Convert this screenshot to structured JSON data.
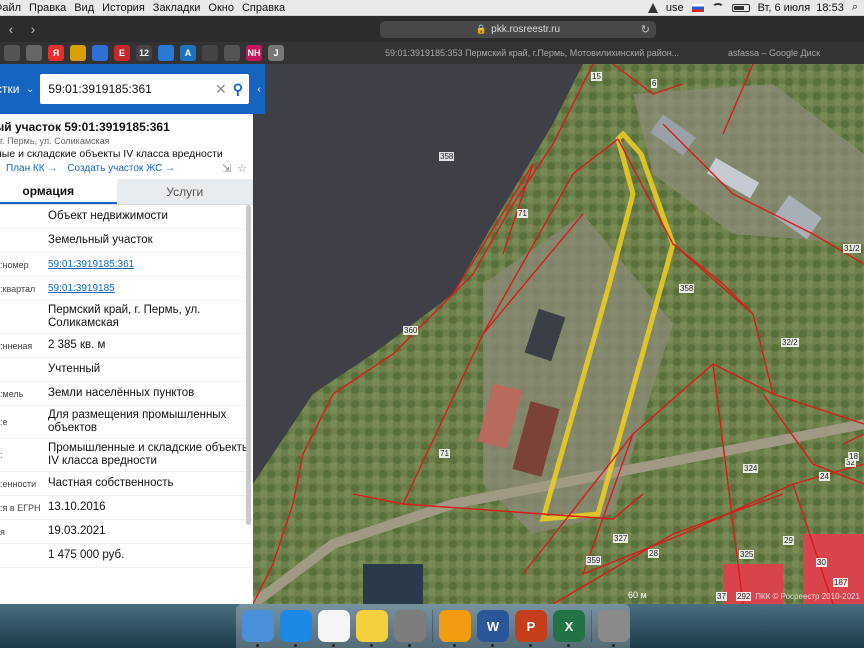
{
  "menubar": {
    "items": [
      "Файл",
      "Правка",
      "Вид",
      "История",
      "Закладки",
      "Окно",
      "Справка"
    ],
    "user": "use",
    "datetime": "Вт, 6 июля  18:53"
  },
  "browser": {
    "url": "pkk.rosreestr.ru",
    "bookmarks": [
      {
        "icon": "apps-icon",
        "label": "",
        "color": "#555"
      },
      {
        "icon": "tab-icon",
        "label": "",
        "color": "#666"
      },
      {
        "icon": "yandex-icon",
        "label": "Я",
        "color": "#e62e2e"
      },
      {
        "icon": "bookmark-icon",
        "label": "",
        "color": "#d8a000"
      },
      {
        "icon": "mail-icon",
        "label": "",
        "color": "#2f6fd6"
      },
      {
        "icon": "e-icon",
        "label": "E",
        "color": "#c62828"
      },
      {
        "icon": "twelve-icon",
        "label": "12",
        "color": "#444"
      },
      {
        "icon": "star-icon",
        "label": "",
        "color": "#2a7ad5"
      },
      {
        "icon": "a-icon",
        "label": "A",
        "color": "#1e73be"
      },
      {
        "icon": "dots-icon",
        "label": "",
        "color": "#444"
      },
      {
        "icon": "globe-icon",
        "label": "",
        "color": "#555"
      },
      {
        "icon": "nh-icon",
        "label": "NH",
        "color": "#c2185b"
      },
      {
        "icon": "j-icon",
        "label": "J",
        "color": "#777"
      }
    ],
    "tab_title": "59:01:3919185:353 Пермский край, г.Пермь, Мотовилихинский район...",
    "tab_title2": "asfassa – Google Диск"
  },
  "panel": {
    "search_type": "стки",
    "search_value": "59:01:3919185:361",
    "title": "ый участок 59:01:3919185:361",
    "address": "г. Пермь, ул. Соликамская",
    "purpose": "ные и складские объекты IV класса вредности",
    "link_plan": "План КК",
    "link_create": "Создать участок ЖС",
    "tab_info": "ормация",
    "tab_services": "Услуги",
    "rows": [
      {
        "key": "",
        "value": "Объект недвижимости",
        "link": false
      },
      {
        "key": "",
        "value": "Земельный участок",
        "link": false
      },
      {
        "key": "номер:",
        "value": "59:01:3919185:361",
        "link": true
      },
      {
        "key": "квартал:",
        "value": "59:01:3919185",
        "link": true
      },
      {
        "key": "",
        "value": "Пермский край, г. Пермь, ул. Соликамская",
        "link": false
      },
      {
        "key": "нненая:",
        "value": "2 385 кв. м",
        "link": false
      },
      {
        "key": "",
        "value": "Учтенный",
        "link": false
      },
      {
        "key": "мель:",
        "value": "Земли населённых пунктов",
        "link": false
      },
      {
        "key": "е:",
        "value": "Для размещения промышленных объектов",
        "link": false
      },
      {
        "key": ":",
        "value": "Промышленные и складские объекты IV класса вредности",
        "link": false
      },
      {
        "key": "енности:",
        "value": "Частная собственность",
        "link": false
      },
      {
        "key": "я в ЕГРН:",
        "value": "13.10.2016",
        "link": false
      },
      {
        "key": "я",
        "value": "19.03.2021",
        "link": false
      },
      {
        "key": "",
        "value": "1 475 000 руб.",
        "link": false
      }
    ]
  },
  "map": {
    "labels": [
      "358",
      "360",
      "358",
      "71",
      "71",
      "359",
      "327",
      "28",
      "324",
      "325",
      "37",
      "292",
      "30",
      "187",
      "31/2",
      "32/2",
      "6",
      "15",
      "24",
      "29",
      "32",
      "18"
    ],
    "scale": "60 м",
    "attribution": "ПКК © Росреестр 2010-2021"
  },
  "dock": {
    "apps": [
      {
        "name": "finder-icon",
        "label": "",
        "color": "#4a90d9"
      },
      {
        "name": "safari-icon",
        "label": "",
        "color": "#1e88e5"
      },
      {
        "name": "photos-icon",
        "label": "",
        "color": "#f5f5f5"
      },
      {
        "name": "notes-icon",
        "label": "",
        "color": "#f4d03f"
      },
      {
        "name": "preferences-icon",
        "label": "",
        "color": "#7d7d7d"
      },
      {
        "name": "vlc-icon",
        "label": "",
        "color": "#f39c12"
      },
      {
        "name": "word-icon",
        "label": "W",
        "color": "#2b579a"
      },
      {
        "name": "powerpoint-icon",
        "label": "P",
        "color": "#c43e1c"
      },
      {
        "name": "excel-icon",
        "label": "X",
        "color": "#217346"
      },
      {
        "name": "trash-icon",
        "label": "",
        "color": "#8a8a8a"
      }
    ]
  }
}
